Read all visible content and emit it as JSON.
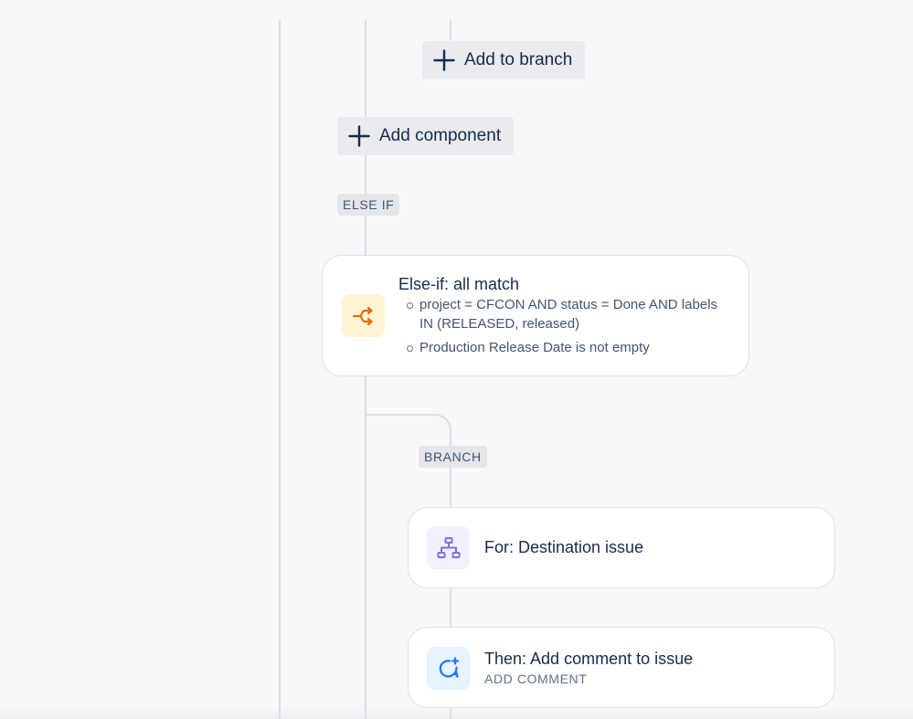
{
  "flow": {
    "add_to_branch": {
      "label": "Add to branch",
      "icon": "plus-icon"
    },
    "add_component": {
      "label": "Add component",
      "icon": "plus-icon"
    },
    "else_if_lozenge": "ELSE IF",
    "branch_lozenge": "BRANCH",
    "else_if_card": {
      "title": "Else-if: all match",
      "icon": "branch-arrows-icon",
      "icon_color": "#e56910",
      "icon_bg": "#fff5d6",
      "conditions": [
        "project = CFCON AND status = Done AND labels IN (RELEASED, released)",
        "Production Release Date is not empty"
      ]
    },
    "for_card": {
      "title": "For: Destination issue",
      "icon": "hierarchy-icon",
      "icon_color": "#8270db",
      "icon_bg": "#f3f0ff"
    },
    "comment_card": {
      "title": "Then: Add comment to issue",
      "subtitle": "ADD COMMENT",
      "icon": "add-comment-icon",
      "icon_color": "#1d7afc",
      "icon_bg": "#e9f2ff"
    }
  },
  "colors": {
    "background": "#f7f8f9",
    "connector": "#dcdfe4",
    "button_bg": "#e9ebee",
    "text": "#172b4d"
  }
}
